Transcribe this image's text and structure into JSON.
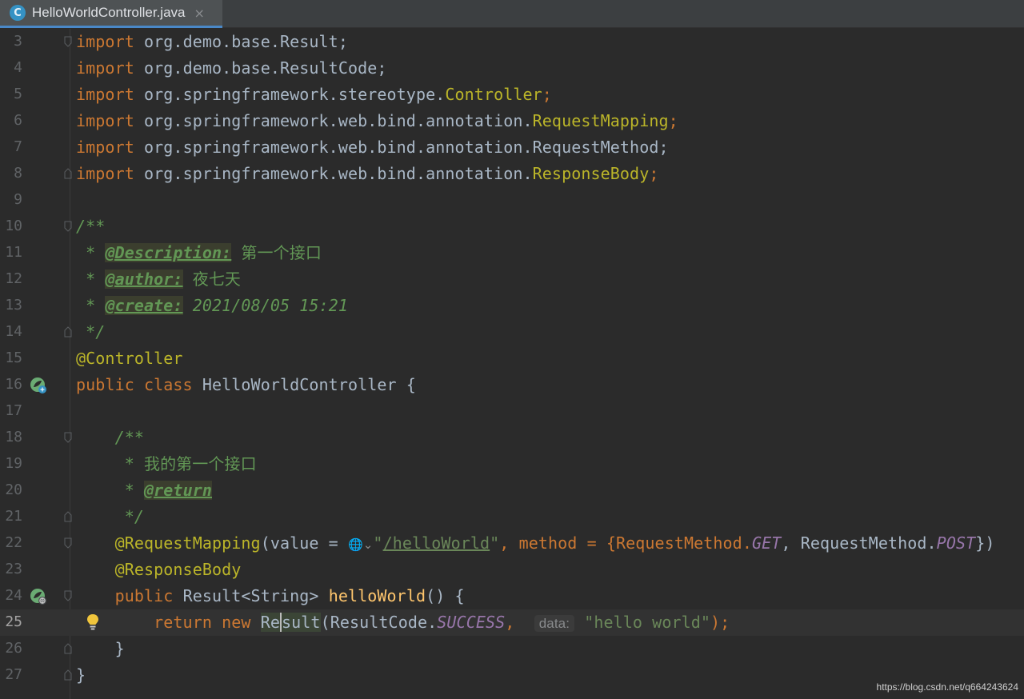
{
  "tab": {
    "icon_letter": "C",
    "title": "HelloWorldController.java",
    "close_glyph": "×"
  },
  "lines": [
    {
      "n": "3",
      "t1": "import",
      "t2": " org.demo.base.Result;"
    },
    {
      "n": "4",
      "t1": "import",
      "t2": " org.demo.base.ResultCode;"
    },
    {
      "n": "5",
      "t1": "import",
      "t2": " org.springframework.stereotype.",
      "t3": "Controller",
      "t4": ";"
    },
    {
      "n": "6",
      "t1": "import",
      "t2": " org.springframework.web.bind.annotation.",
      "t3": "RequestMapping",
      "t4": ";"
    },
    {
      "n": "7",
      "t1": "import",
      "t2": " org.springframework.web.bind.annotation.RequestMethod;"
    },
    {
      "n": "8",
      "t1": "import",
      "t2": " org.springframework.web.bind.annotation.",
      "t3": "ResponseBody",
      "t4": ";"
    },
    {
      "n": "9"
    },
    {
      "n": "10",
      "t1": "/**"
    },
    {
      "n": "11",
      "t1": " * ",
      "t2": "@Description:",
      "t3": " 第一个接口"
    },
    {
      "n": "12",
      "t1": " * ",
      "t2": "@author:",
      "t3": " 夜七天"
    },
    {
      "n": "13",
      "t1": " * ",
      "t2": "@create:",
      "t3": " 2021/08/05 15:21"
    },
    {
      "n": "14",
      "t1": " */"
    },
    {
      "n": "15",
      "t1": "@Controller"
    },
    {
      "n": "16",
      "t1": "public class",
      "t2": " HelloWorldController {"
    },
    {
      "n": "17"
    },
    {
      "n": "18",
      "t1": "    /**"
    },
    {
      "n": "19",
      "t1": "     * 我的第一个接口"
    },
    {
      "n": "20",
      "t1": "     * ",
      "t2": "@return"
    },
    {
      "n": "21",
      "t1": "     */"
    },
    {
      "n": "22",
      "t1": "    @RequestMapping",
      "t2": "(value = ",
      "t3": "\"",
      "t4": "/helloWorld",
      "t5": "\"",
      "t6": ", method = {RequestMethod.",
      "t7": "GET",
      "t8": ", RequestMethod.",
      "t9": "POST",
      "t10": "})"
    },
    {
      "n": "23",
      "t1": "    @ResponseBody"
    },
    {
      "n": "24",
      "t1": "    public",
      "t2": " Result<String> ",
      "t3": "helloWorld",
      "t4": "() {"
    },
    {
      "n": "25",
      "t1": "        return new ",
      "t2": "Re",
      "t3": "sult",
      "t4": "(ResultCode.",
      "t5": "SUCCESS",
      "t6": ",",
      "hint": "data:",
      "t7": "\"hello world\"",
      "t8": ");"
    },
    {
      "n": "26",
      "t1": "    }"
    },
    {
      "n": "27",
      "t1": "}"
    }
  ],
  "icons": {
    "tab": "java-class-icon",
    "gutter16": "spring-bean-icon",
    "gutter24": "spring-web-endpoint-icon",
    "bulb": "intention-bulb-icon",
    "globe": "globe-url-icon"
  },
  "colors": {
    "background": "#2b2b2b",
    "keyword": "#cc7832",
    "annotation": "#bbb529",
    "string": "#6a8759",
    "comment": "#629755",
    "constant": "#9876aa",
    "method": "#ffc66d",
    "default_text": "#a9b7c6",
    "tab_accent": "#4a88c7"
  },
  "watermark": "https://blog.csdn.net/q664243624"
}
